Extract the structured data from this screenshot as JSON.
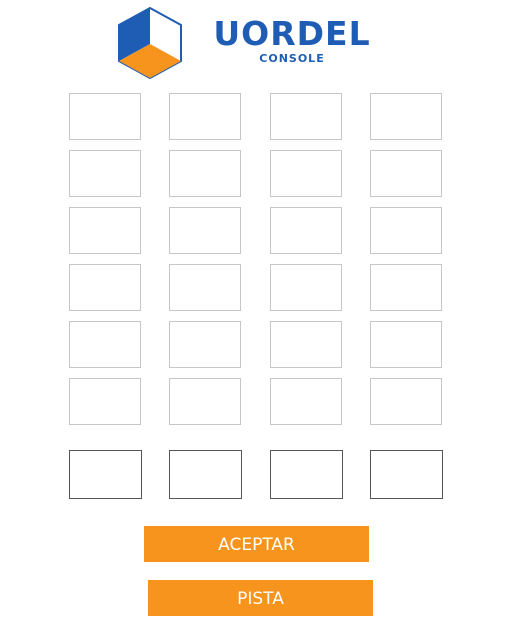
{
  "logo": {
    "wordmark": "UORDEL",
    "subtitle": "CONSOLE",
    "colors": {
      "blue": "#1f5db5",
      "orange": "#f7941d"
    }
  },
  "board": {
    "rows": 6,
    "columns": 4,
    "cells": [
      [
        "",
        "",
        "",
        ""
      ],
      [
        "",
        "",
        "",
        ""
      ],
      [
        "",
        "",
        "",
        ""
      ],
      [
        "",
        "",
        "",
        ""
      ],
      [
        "",
        "",
        "",
        ""
      ],
      [
        "",
        "",
        "",
        ""
      ]
    ]
  },
  "input": {
    "letters": [
      "",
      "",
      "",
      ""
    ]
  },
  "buttons": {
    "accept_label": "ACEPTAR",
    "hint_label": "PISTA",
    "color": "#f7941d"
  }
}
